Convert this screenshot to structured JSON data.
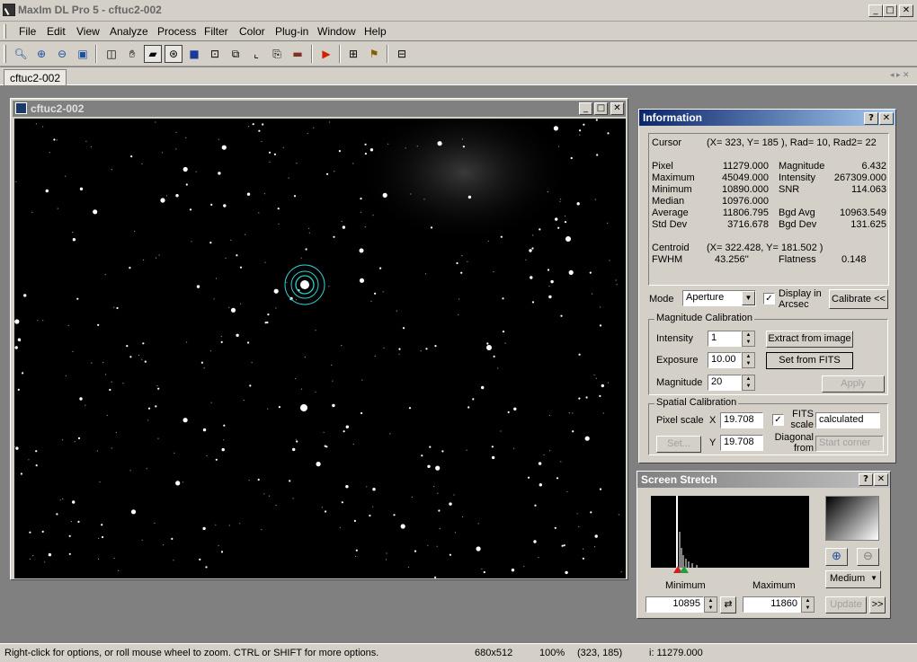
{
  "window": {
    "title": "MaxIm DL Pro 5 - cftuc2-002"
  },
  "menu": [
    "File",
    "Edit",
    "View",
    "Analyze",
    "Process",
    "Filter",
    "Color",
    "Plug-in",
    "Window",
    "Help"
  ],
  "tabs": {
    "active": "cftuc2-002"
  },
  "image_window": {
    "title": "cftuc2-002"
  },
  "info": {
    "title": "Information",
    "cursor_label": "Cursor",
    "cursor_value": "(X=  323, Y=  185 ), Rad= 10, Rad2= 22",
    "stats_left": [
      [
        "Pixel",
        "11279.000"
      ],
      [
        "Maximum",
        "45049.000"
      ],
      [
        "Minimum",
        "10890.000"
      ],
      [
        "Median",
        "10976.000"
      ],
      [
        "Average",
        "11806.795"
      ],
      [
        "Std Dev",
        "3716.678"
      ]
    ],
    "stats_right": [
      [
        "Magnitude",
        "6.432"
      ],
      [
        "Intensity",
        "267309.000"
      ],
      [
        "SNR",
        "114.063"
      ],
      [
        "",
        ""
      ],
      [
        "Bgd Avg",
        "10963.549"
      ],
      [
        "Bgd Dev",
        "131.625"
      ]
    ],
    "centroid_label": "Centroid",
    "centroid_value": "(X=  322.428, Y=  181.502 )",
    "fwhm_label": "FWHM",
    "fwhm_value": "43.256''",
    "flatness_label": "Flatness",
    "flatness_value": "0.148",
    "mode_label": "Mode",
    "mode_value": "Aperture",
    "display_arcsec_label": "Display in Arcsec",
    "calibrate_button": "Calibrate <<",
    "mag_cal": {
      "legend": "Magnitude Calibration",
      "intensity_label": "Intensity",
      "intensity_value": "1",
      "exposure_label": "Exposure",
      "exposure_value": "10.00",
      "magnitude_label": "Magnitude",
      "magnitude_value": "20",
      "extract_button": "Extract from image",
      "set_fits_button": "Set from FITS",
      "apply_button": "Apply"
    },
    "spatial_cal": {
      "legend": "Spatial Calibration",
      "pixel_scale_label": "Pixel scale",
      "x_label": "X",
      "x_value": "19.708",
      "y_label": "Y",
      "y_value": "19.708",
      "fits_scale_label": "FITS scale",
      "fits_scale_value": "calculated",
      "diagonal_label": "Diagonal from",
      "diagonal_value": "Start corner",
      "set_button": "Set..."
    }
  },
  "stretch": {
    "title": "Screen Stretch",
    "minimum_label": "Minimum",
    "maximum_label": "Maximum",
    "minimum_value": "10895",
    "maximum_value": "11860",
    "mode_value": "Medium",
    "update_button": "Update",
    "more_button": ">>"
  },
  "status": {
    "hint": "Right-click for options, or roll mouse wheel to zoom. CTRL or SHIFT for more options.",
    "size": "680x512",
    "zoom": "100%",
    "coords": "(323, 185)",
    "intensity": "i: 11279.000"
  }
}
